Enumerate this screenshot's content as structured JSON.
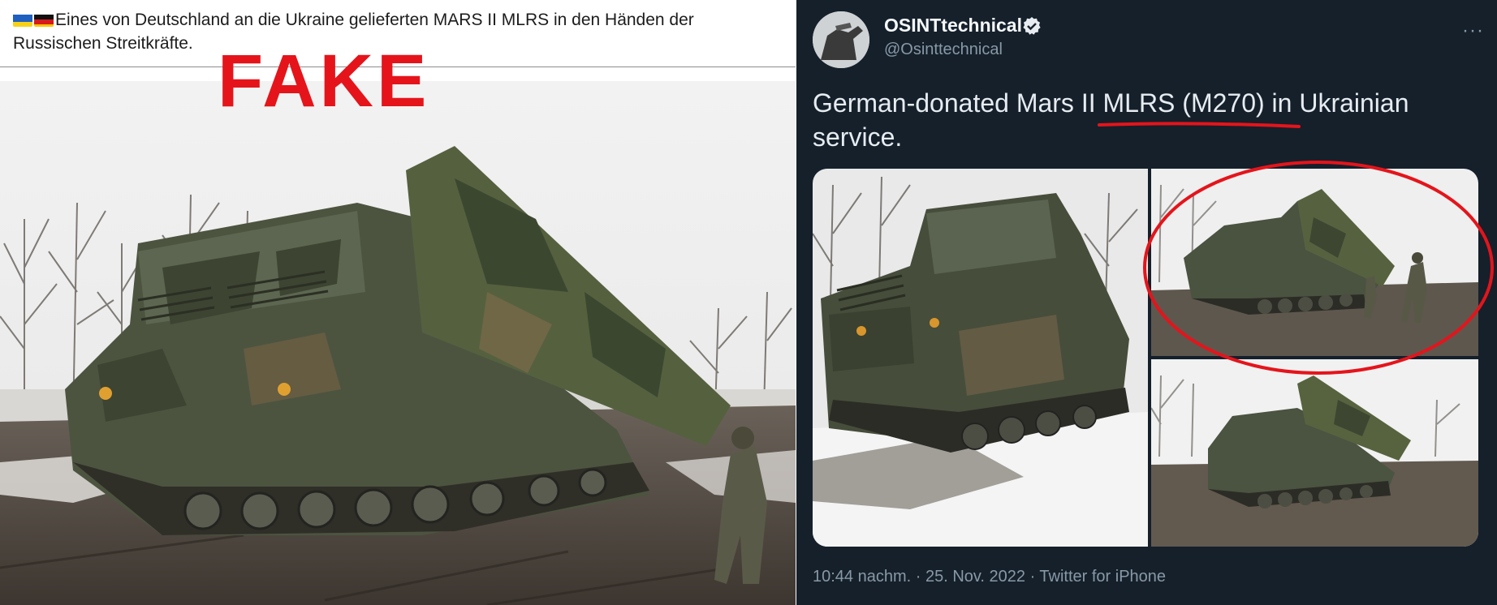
{
  "left_post": {
    "flags": [
      "ukraine-flag",
      "germany-flag"
    ],
    "caption": "Eines von Deutschland an die Ukraine gelieferten MARS II MLRS in den Händen der Russischen  Streitkräfte.",
    "stamp": "FAKE",
    "stamp_color": "#e5141b"
  },
  "tweet": {
    "display_name": "OSINTtechnical",
    "handle": "@Osinttechnical",
    "text": "German-donated Mars II MLRS (M270) in Ukrainian service.",
    "meta": "10:44 nachm. · 25. Nov. 2022 · Twitter for iPhone",
    "icons": [
      "verified-badge-icon",
      "more-options-icon"
    ],
    "annotation_color": "#e5141b",
    "background": "#15202b"
  }
}
